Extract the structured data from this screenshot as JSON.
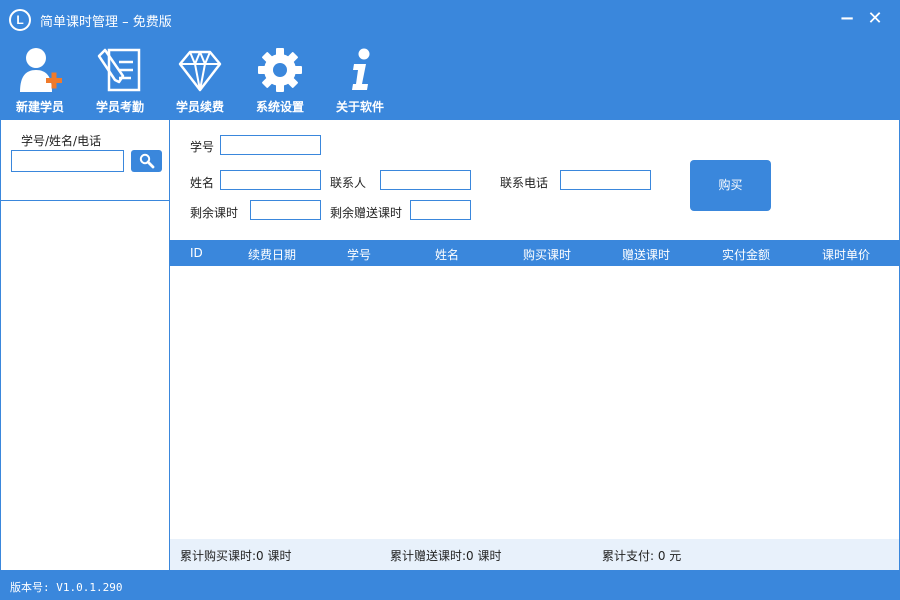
{
  "app": {
    "logo_letter": "L",
    "title": "简单课时管理 – 免费版",
    "minimize_glyph": "−",
    "close_glyph": "✕"
  },
  "toolbar": {
    "items": [
      {
        "label": "新建学员",
        "icon": "user-add-icon"
      },
      {
        "label": "学员考勤",
        "icon": "edit-document-icon"
      },
      {
        "label": "学员续费",
        "icon": "diamond-icon"
      },
      {
        "label": "系统设置",
        "icon": "gear-icon"
      },
      {
        "label": "关于软件",
        "icon": "info-icon"
      }
    ]
  },
  "sidebar": {
    "search_label": "学号/姓名/电话",
    "search_value": "",
    "search_icon": "search-icon"
  },
  "form": {
    "student_id_label": "学号",
    "student_id_value": "",
    "name_label": "姓名",
    "name_value": "",
    "contact_label": "联系人",
    "contact_value": "",
    "phone_label": "联系电话",
    "phone_value": "",
    "remaining_label": "剩余课时",
    "remaining_value": "",
    "remaining_gift_label": "剩余赠送课时",
    "remaining_gift_value": "",
    "buy_label": "购买"
  },
  "table": {
    "columns": [
      "ID",
      "续费日期",
      "学号",
      "姓名",
      "购买课时",
      "赠送课时",
      "实付金额",
      "课时单价"
    ],
    "rows": []
  },
  "summary": {
    "purchased": "累计购买课时:0 课时",
    "gifted": "累计赠送课时:0 课时",
    "paid": "累计支付:  0 元"
  },
  "status": {
    "version": "版本号: V1.0.1.290"
  },
  "colors": {
    "accent": "#3a87dc",
    "summary_bg": "#e8f1fb"
  }
}
